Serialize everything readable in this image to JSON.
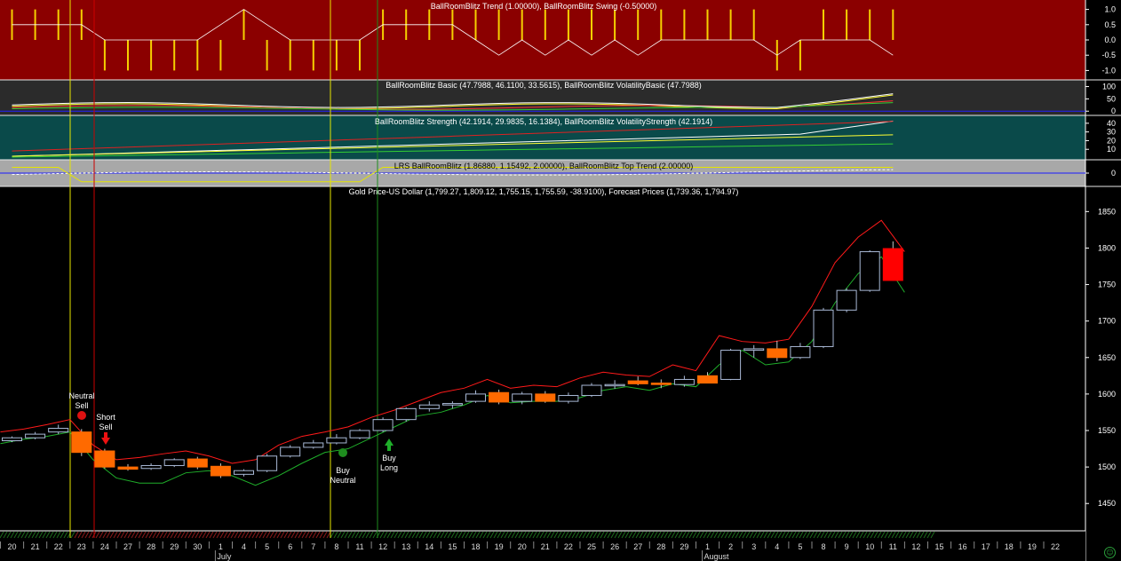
{
  "panels": {
    "trend": {
      "title": "BallRoomBlitz Trend (1.00000), BallRoomBlitz Swing (-0.50000)",
      "ticks": [
        "1.0",
        "0.5",
        "0.0",
        "-0.5",
        "-1.0"
      ],
      "tick_values": [
        1.0,
        0.5,
        0.0,
        -0.5,
        -1.0
      ],
      "ylim": [
        -1.25,
        1.25
      ],
      "bg": "#8b0000"
    },
    "basic": {
      "title": "BallRoomBlitz Basic (47.7988, 46.1100, 33.5615), BallRoomBlitz VolatilityBasic (47.7988)",
      "ticks": [
        "100",
        "50",
        "0"
      ],
      "tick_values": [
        100,
        50,
        0
      ],
      "ylim": [
        -10,
        120
      ],
      "bg": "#2b2b2b"
    },
    "strength": {
      "title": "BallRoomBlitz Strength (42.1914, 29.9835, 16.1384), BallRoomBlitz VolatilityStrength (42.1914)",
      "ticks": [
        "40",
        "30",
        "20",
        "10"
      ],
      "tick_values": [
        40,
        30,
        20,
        10
      ],
      "ylim": [
        0,
        47
      ],
      "bg": "#0a4a4a"
    },
    "lrs": {
      "title": "LRS BallRoomBlitz (1.86880, 1.15492, 2.00000), BallRoomBlitz Top Trend (2.00000)",
      "ticks": [
        "0"
      ],
      "tick_values": [
        0
      ],
      "ylim": [
        -8,
        8
      ],
      "bg": "#a8a8a8"
    },
    "price": {
      "title": "Gold Price-US Dollar (1,799.27, 1,809.12, 1,755.15, 1,755.59, -38.9100), Forecast Prices (1,739.36, 1,794.97)",
      "ticks": [
        "1850",
        "1800",
        "1750",
        "1700",
        "1650",
        "1600",
        "1550",
        "1500",
        "1450"
      ],
      "tick_values": [
        1850,
        1800,
        1750,
        1700,
        1650,
        1600,
        1550,
        1500,
        1450
      ],
      "ylim": [
        1415,
        1865
      ]
    }
  },
  "x_axis": {
    "day_labels": [
      "20",
      "21",
      "22",
      "23",
      "24",
      "27",
      "28",
      "29",
      "30",
      "1",
      "4",
      "5",
      "6",
      "7",
      "8",
      "11",
      "12",
      "13",
      "14",
      "15",
      "18",
      "19",
      "20",
      "21",
      "22",
      "25",
      "26",
      "27",
      "28",
      "29",
      "1",
      "2",
      "3",
      "4",
      "5",
      "8",
      "9",
      "10",
      "11",
      "12",
      "15",
      "16",
      "17",
      "18",
      "19",
      "22"
    ],
    "month_labels": [
      "July",
      "August"
    ],
    "month_label_index": [
      9,
      30
    ]
  },
  "signals": [
    {
      "lines": [
        "Neutral",
        "Sell"
      ],
      "index": 3,
      "kind": "neutral-sell"
    },
    {
      "lines": [
        "Short",
        "Sell"
      ],
      "index": 4,
      "kind": "short-sell"
    },
    {
      "lines": [
        "Buy",
        "Neutral"
      ],
      "index": 14,
      "kind": "buy-neutral"
    },
    {
      "lines": [
        "Buy",
        "Long"
      ],
      "index": 16,
      "kind": "buy-long"
    }
  ],
  "colors": {
    "up_candle": "#a9b9d6",
    "down_candle": "#ff6a00",
    "strong_down": "#ff0000",
    "upper_forecast": "#ff1a1a",
    "lower_forecast": "#1fae2a",
    "yellow_vline": "#e6e600",
    "red_vline": "#cc0000",
    "green_vline": "#1e8c1e"
  },
  "chart_data": {
    "type": "candlestick",
    "title": "Gold Price-US Dollar (1,799.27, 1,809.12, 1,755.15, 1,755.59, -38.9100), Forecast Prices (1,739.36, 1,794.97)",
    "x": [
      "20",
      "21",
      "22",
      "23",
      "24",
      "27",
      "28",
      "29",
      "30",
      "1",
      "4",
      "5",
      "6",
      "7",
      "8",
      "11",
      "12",
      "13",
      "14",
      "15",
      "18",
      "19",
      "20",
      "21",
      "22",
      "25",
      "26",
      "27",
      "28",
      "29",
      "1",
      "2",
      "3",
      "4",
      "5",
      "8",
      "9",
      "10",
      "11"
    ],
    "ohlc": [
      [
        1536,
        1542,
        1534,
        1540
      ],
      [
        1540,
        1548,
        1538,
        1545
      ],
      [
        1548,
        1558,
        1545,
        1553
      ],
      [
        1548,
        1552,
        1515,
        1520
      ],
      [
        1522,
        1525,
        1498,
        1500
      ],
      [
        1500,
        1504,
        1495,
        1497
      ],
      [
        1498,
        1505,
        1496,
        1502
      ],
      [
        1502,
        1512,
        1500,
        1510
      ],
      [
        1511,
        1514,
        1497,
        1500
      ],
      [
        1501,
        1505,
        1485,
        1488
      ],
      [
        1490,
        1497,
        1487,
        1495
      ],
      [
        1495,
        1518,
        1493,
        1515
      ],
      [
        1515,
        1530,
        1513,
        1527
      ],
      [
        1527,
        1537,
        1525,
        1533
      ],
      [
        1533,
        1545,
        1531,
        1540
      ],
      [
        1540,
        1552,
        1538,
        1550
      ],
      [
        1550,
        1568,
        1548,
        1565
      ],
      [
        1565,
        1582,
        1562,
        1580
      ],
      [
        1580,
        1590,
        1576,
        1585
      ],
      [
        1585,
        1590,
        1580,
        1587
      ],
      [
        1590,
        1605,
        1588,
        1600
      ],
      [
        1602,
        1606,
        1586,
        1589
      ],
      [
        1590,
        1603,
        1586,
        1600
      ],
      [
        1600,
        1604,
        1588,
        1590
      ],
      [
        1590,
        1602,
        1587,
        1598
      ],
      [
        1598,
        1615,
        1596,
        1612
      ],
      [
        1613,
        1619,
        1607,
        1613
      ],
      [
        1618,
        1624,
        1612,
        1614
      ],
      [
        1615,
        1620,
        1608,
        1613
      ],
      [
        1613,
        1625,
        1610,
        1620
      ],
      [
        1625,
        1630,
        1617,
        1615
      ],
      [
        1620,
        1662,
        1619,
        1660
      ],
      [
        1660,
        1667,
        1650,
        1662
      ],
      [
        1662,
        1673,
        1645,
        1650
      ],
      [
        1650,
        1670,
        1648,
        1665
      ],
      [
        1665,
        1718,
        1663,
        1715
      ],
      [
        1715,
        1745,
        1712,
        1742
      ],
      [
        1742,
        1797,
        1740,
        1795
      ],
      [
        1799.27,
        1809.12,
        1755.15,
        1755.59
      ]
    ],
    "upper_forecast": [
      1548,
      1552,
      1558,
      1565,
      1530,
      1510,
      1513,
      1518,
      1522,
      1515,
      1505,
      1510,
      1530,
      1542,
      1548,
      1555,
      1568,
      1578,
      1590,
      1602,
      1608,
      1620,
      1608,
      1612,
      1610,
      1622,
      1630,
      1626,
      1624,
      1640,
      1632,
      1680,
      1672,
      1670,
      1675,
      1720,
      1780,
      1815,
      1838,
      1794.97
    ],
    "lower_forecast": [
      1532,
      1538,
      1542,
      1548,
      1510,
      1485,
      1478,
      1478,
      1492,
      1495,
      1488,
      1475,
      1488,
      1505,
      1520,
      1525,
      1540,
      1555,
      1570,
      1575,
      1585,
      1598,
      1588,
      1590,
      1590,
      1595,
      1605,
      1610,
      1605,
      1614,
      1610,
      1640,
      1660,
      1640,
      1644,
      1672,
      1725,
      1765,
      1788,
      1739.36
    ],
    "ylabel": "",
    "ylim": [
      1415,
      1865
    ],
    "legend": "none"
  }
}
